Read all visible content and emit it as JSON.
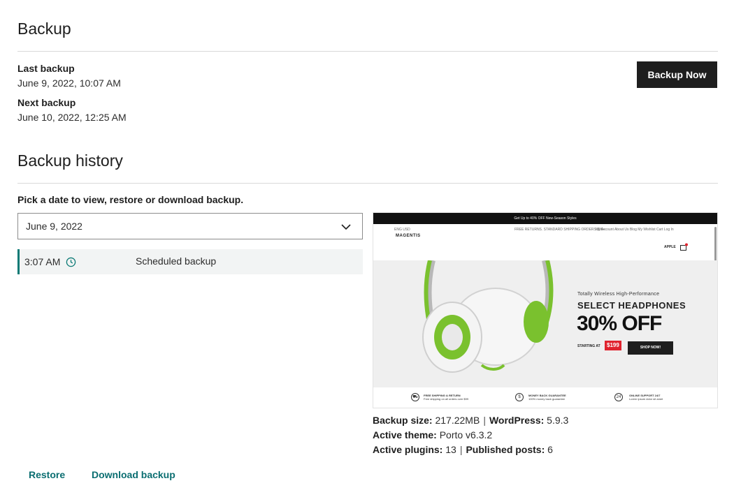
{
  "backup": {
    "title": "Backup",
    "last_label": "Last backup",
    "last_value": "June 9, 2022, 10:07 AM",
    "next_label": "Next backup",
    "next_value": "June 10, 2022, 12:25 AM",
    "backup_now_label": "Backup Now"
  },
  "history": {
    "title": "Backup history",
    "instruction": "Pick a date to view, restore or download backup.",
    "selected_date": "June 9, 2022",
    "rows": [
      {
        "time": "3:07 AM",
        "type": "Scheduled backup",
        "icon": "clock-icon"
      }
    ]
  },
  "preview": {
    "topbar": "Get Up to 40% OFF New-Season Styles",
    "nav_left": "ENG  USD",
    "nav_center": "FREE RETURNS. STANDARD SHIPPING ORDERS $99+",
    "nav_right": "My Account   About Us   Blog   My Wishlist   Cart   Log In",
    "logo": "MAGENTIS",
    "cart_label": "APPLE",
    "promo_small": "Totally Wireless High-Performance",
    "promo_title": "SELECT HEADPHONES",
    "promo_big": "30% OFF",
    "starting_at": "STARTING AT",
    "price": "$199",
    "shop_now": "SHOP NOW!",
    "features": [
      {
        "title": "FREE SHIPPING & RETURN",
        "sub": "Free shipping on all orders over $99"
      },
      {
        "title": "MONEY BACK GUARANTEE",
        "sub": "100% money back guarantee"
      },
      {
        "title": "ONLINE SUPPORT 24/7",
        "sub": "Lorem ipsum dolor sit amet"
      }
    ]
  },
  "details": {
    "size_label": "Backup size:",
    "size_value": "217.22MB",
    "wp_label": "WordPress:",
    "wp_value": "5.9.3",
    "theme_label": "Active theme:",
    "theme_value": "Porto v6.3.2",
    "plugins_label": "Active plugins:",
    "plugins_value": "13",
    "posts_label": "Published posts:",
    "posts_value": "6",
    "separator": "|"
  },
  "actions": {
    "restore": "Restore",
    "download": "Download backup"
  },
  "colors": {
    "accent": "#0b6e71",
    "button_bg": "#1e1e1e",
    "row_bg": "#f2f4f4",
    "headphone_green": "#7ac12e"
  }
}
